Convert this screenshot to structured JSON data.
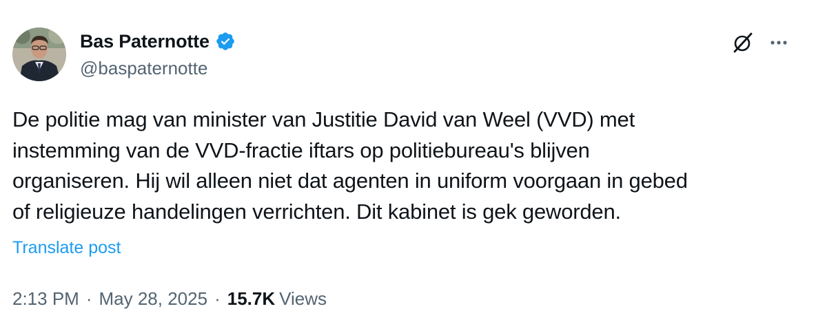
{
  "author": {
    "display_name": "Bas Paternotte",
    "handle": "@baspaternotte",
    "verified": true,
    "verified_color": "#1d9bf0",
    "avatar_icon": "profile-photo"
  },
  "actions": {
    "grok_icon": "grok-icon",
    "more_icon": "more-options-icon"
  },
  "post": {
    "text": "De politie mag van minister van Justitie David van Weel (VVD) met\ninstemming van de VVD-fractie iftars op politiebureau's blijven\norganiseren. Hij wil alleen niet dat agenten in uniform voorgaan in gebed\nof religieuze handelingen verrichten. Dit kabinet is gek geworden.",
    "translate_label": "Translate post"
  },
  "meta": {
    "time": "2:13 PM",
    "separator": "·",
    "date": "May 28, 2025",
    "views_count": "15.7K",
    "views_label": "Views"
  },
  "colors": {
    "text_primary": "#0f1419",
    "text_secondary": "#536471",
    "link": "#1d9bf0"
  }
}
